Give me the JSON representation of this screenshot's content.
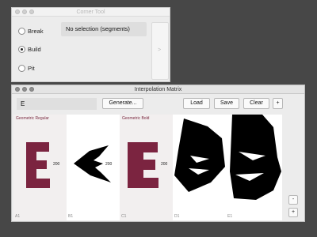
{
  "corner_tool": {
    "title": "Corner Tool",
    "radios": [
      {
        "label": "Break",
        "checked": false
      },
      {
        "label": "Build",
        "checked": true
      },
      {
        "label": "Pit",
        "checked": false
      }
    ],
    "selection_text": "No selection (segments)",
    "side_arrow": ">"
  },
  "matrix": {
    "title": "Interpolation Matrix",
    "glyph_value": "E",
    "buttons": {
      "generate": "Generate...",
      "load": "Load",
      "save": "Save",
      "clear": "Clear",
      "add": "+"
    },
    "accent_color": "#7b2440",
    "cells": [
      {
        "position": "A1",
        "master": "Geometric Regular",
        "number": "200"
      },
      {
        "position": "B1",
        "master": "",
        "number": "200"
      },
      {
        "position": "C1",
        "master": "Geometric Bold",
        "number": "200"
      },
      {
        "position": "D1",
        "master": "",
        "number": ""
      },
      {
        "position": "E1",
        "master": "",
        "number": ""
      }
    ],
    "zoom": {
      "minus": "-",
      "plus": "+"
    }
  }
}
